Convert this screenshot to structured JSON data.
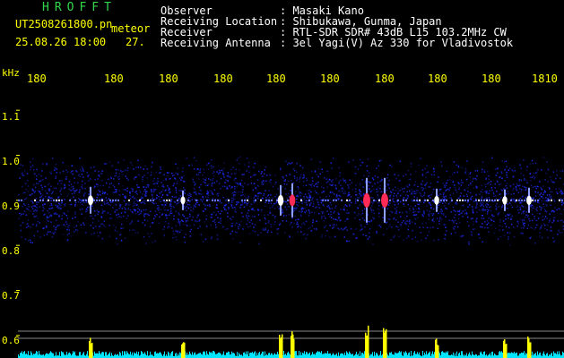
{
  "header": {
    "brand": "HROFFT",
    "filename": "UT2508261800.pn",
    "mode": "meteor",
    "date_time": "25.08.26 18:00",
    "count": "27.",
    "labels": [
      {
        "label": "Observer",
        "value": ": Masaki Kano"
      },
      {
        "label": "Receiving Location",
        "value": ": Shibukawa, Gunma, Japan"
      },
      {
        "label": "Receiver",
        "value": ": RTL-SDR SDR# 43dB L15 103.2MHz CW"
      },
      {
        "label": "Receiving Antenna",
        "value": ": 3el Yagi(V) Az 330 for Vladivostok"
      }
    ]
  },
  "axis": {
    "y_unit": "kHz",
    "y_ticks": [
      "1.1",
      "1.0",
      "0.9",
      "0.8",
      "0.7",
      "0.6"
    ],
    "x_ticks": [
      "180",
      "180",
      "180",
      "180",
      "180",
      "180",
      "180",
      "180",
      "180",
      "1810"
    ]
  },
  "colors": {
    "background": "#000000",
    "text_yellow": "#ffff00",
    "text_green": "#32d74b",
    "noise_blue": "#1f2cff",
    "signal_red": "#ff2a55",
    "signal_white": "#ffffff",
    "histogram_cyan": "#00e5ff",
    "histogram_yellow": "#ffff00"
  },
  "chart_data": {
    "type": "heatmap",
    "y_range_khz": [
      0.55,
      1.15
    ],
    "noise_band_khz": [
      0.8,
      1.0
    ],
    "center_khz": 0.9,
    "events": [
      {
        "x_index": 100,
        "strength": 0.5
      },
      {
        "x_index": 203,
        "strength": 0.3
      },
      {
        "x_index": 312,
        "strength": 0.6
      },
      {
        "x_index": 325,
        "strength": 0.7
      },
      {
        "x_index": 408,
        "strength": 1.0
      },
      {
        "x_index": 428,
        "strength": 1.0
      },
      {
        "x_index": 486,
        "strength": 0.4
      },
      {
        "x_index": 562,
        "strength": 0.35
      },
      {
        "x_index": 589,
        "strength": 0.45
      }
    ]
  }
}
